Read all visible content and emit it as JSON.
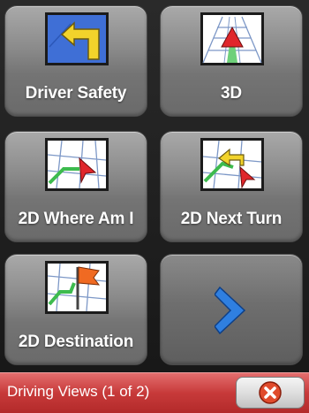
{
  "menu": {
    "tiles": [
      {
        "label": "Driver Safety",
        "icon": "driver-safety-arrow-icon"
      },
      {
        "label": "3D",
        "icon": "3d-map-arrow-icon"
      },
      {
        "label": "2D Where Am I",
        "icon": "2d-map-position-icon"
      },
      {
        "label": "2D Next Turn",
        "icon": "2d-map-turn-icon"
      },
      {
        "label": "2D Destination",
        "icon": "2d-map-destination-flag-icon"
      },
      {
        "label": "",
        "icon": "next-page-chevron-icon"
      }
    ]
  },
  "status_bar": {
    "title": "Driving Views (1 of 2)",
    "close_icon": "close-x-icon"
  },
  "colors": {
    "status_bar": "#c73a3a",
    "chevron": "#2f7fe0",
    "close_badge": "#e04b2c"
  }
}
